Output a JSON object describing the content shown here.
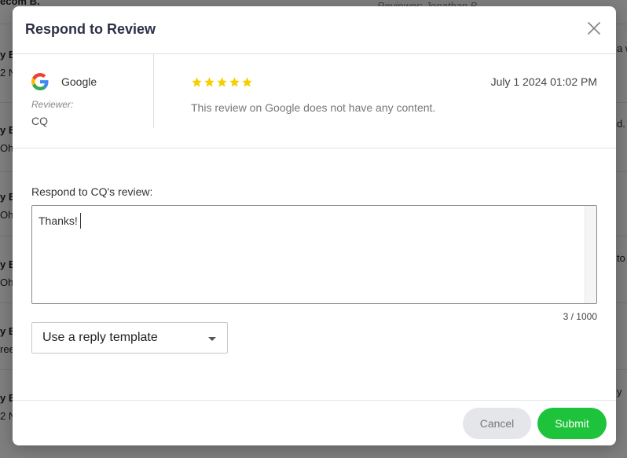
{
  "background": {
    "reviewer_partial": "Reviewer: Jonathan B.",
    "rows": [
      {
        "left_title": "y E",
        "left_sub": "2 N",
        "right_frag": "a w"
      },
      {
        "left_title": "y E",
        "left_sub": "Ohi",
        "right_frag": "d. S"
      },
      {
        "left_title": "y E",
        "left_sub": "Ohi",
        "right_frag": ""
      },
      {
        "left_title": "y E",
        "left_sub": "Ohi",
        "right_frag": "to a"
      },
      {
        "left_title": "y E",
        "left_sub": "ree",
        "right_frag": ""
      },
      {
        "left_title": "y E",
        "left_sub": "2 N",
        "right_frag": "y"
      }
    ],
    "top_left_frag": "ecom B."
  },
  "modal": {
    "title": "Respond to Review",
    "review": {
      "source": "Google",
      "reviewer_label": "Reviewer:",
      "reviewer_name": "CQ",
      "rating": 5,
      "date": "July 1 2024 01:02 PM",
      "content": "This review on Google does not have any content."
    },
    "respond_label": "Respond to CQ's review:",
    "reply_text": "Thanks!",
    "char_count": "3 / 1000",
    "template_select": "Use a reply template",
    "cancel_label": "Cancel",
    "submit_label": "Submit"
  },
  "colors": {
    "title": "#2d3047",
    "star": "#f5d000",
    "submit": "#1ec33c",
    "cancel_bg": "#e4e6ea"
  },
  "icons": {
    "close": "close-icon",
    "google": "google-logo-icon",
    "star": "star-icon",
    "dropdown": "chevron-down-icon"
  }
}
